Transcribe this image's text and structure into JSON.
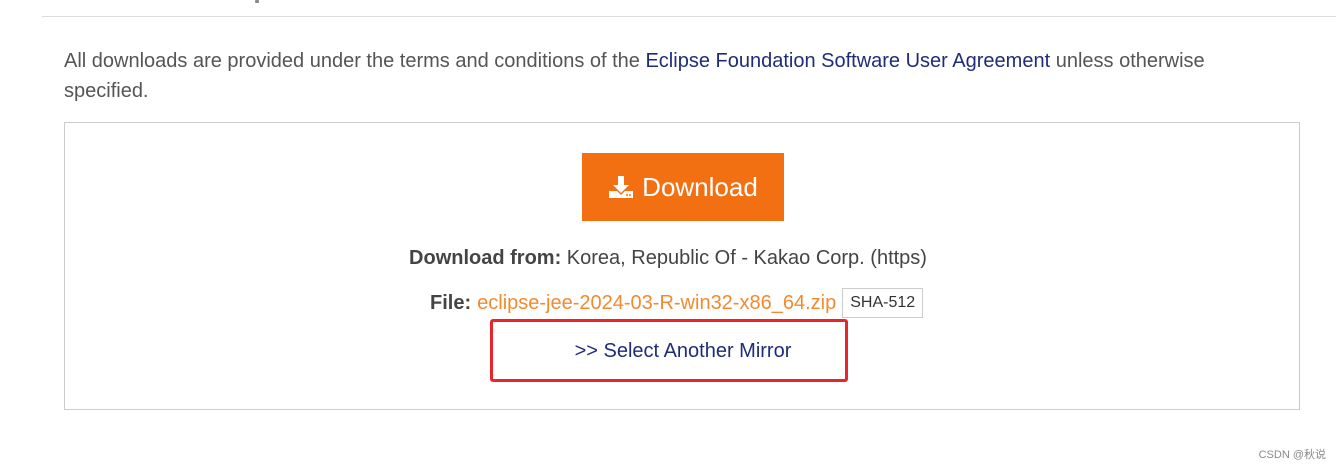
{
  "terms": {
    "prefix": "All downloads are provided under the terms and conditions of the ",
    "link": "Eclipse Foundation Software User Agreement",
    "suffix": " unless otherwise specified."
  },
  "download_button": {
    "label": "Download",
    "icon": "download-icon",
    "color": "#f27011"
  },
  "download_from": {
    "label": "Download from:",
    "value": " Korea, Republic Of - Kakao Corp. (https)"
  },
  "file": {
    "label": "File:",
    "name": "eclipse-jee-2024-03-R-win32-x86_64.zip",
    "checksum_button": "SHA-512"
  },
  "mirror_link": ">> Select Another Mirror",
  "annotation": {
    "color": "#e8252b"
  },
  "watermark": "CSDN @秋说"
}
